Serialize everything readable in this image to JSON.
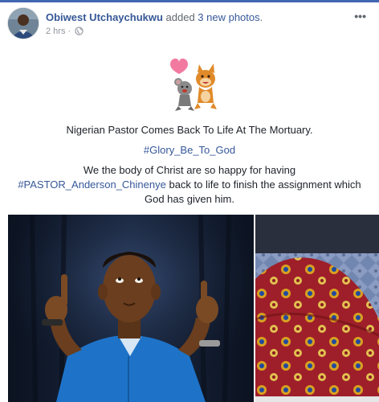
{
  "post": {
    "author": "Obiwest Utchaychukwu",
    "action": " added ",
    "photos_count": "3 new photos",
    "action_end": ".",
    "time": "2 hrs",
    "separator": " · ",
    "more_label": "•••",
    "icons": {
      "avatar": "profile-photo",
      "privacy": "globe-icon",
      "more": "more-options-icon",
      "sticker": "love-sticker"
    }
  },
  "content": {
    "headline": "Nigerian Pastor Comes Back To Life At The Mortuary.",
    "hashtag_glory": "#Glory_Be_To_God",
    "body_line1": "We the body of Christ are so happy for having",
    "hashtag_pastor": "#PASTOR_Anderson_Chinenye",
    "body_line2_rest": " back to life to finish the assignment which",
    "body_line3": "God has given him."
  },
  "colors": {
    "link": "#365899",
    "text": "#1d2129",
    "meta": "#90949c",
    "accent": "#4267b2"
  }
}
